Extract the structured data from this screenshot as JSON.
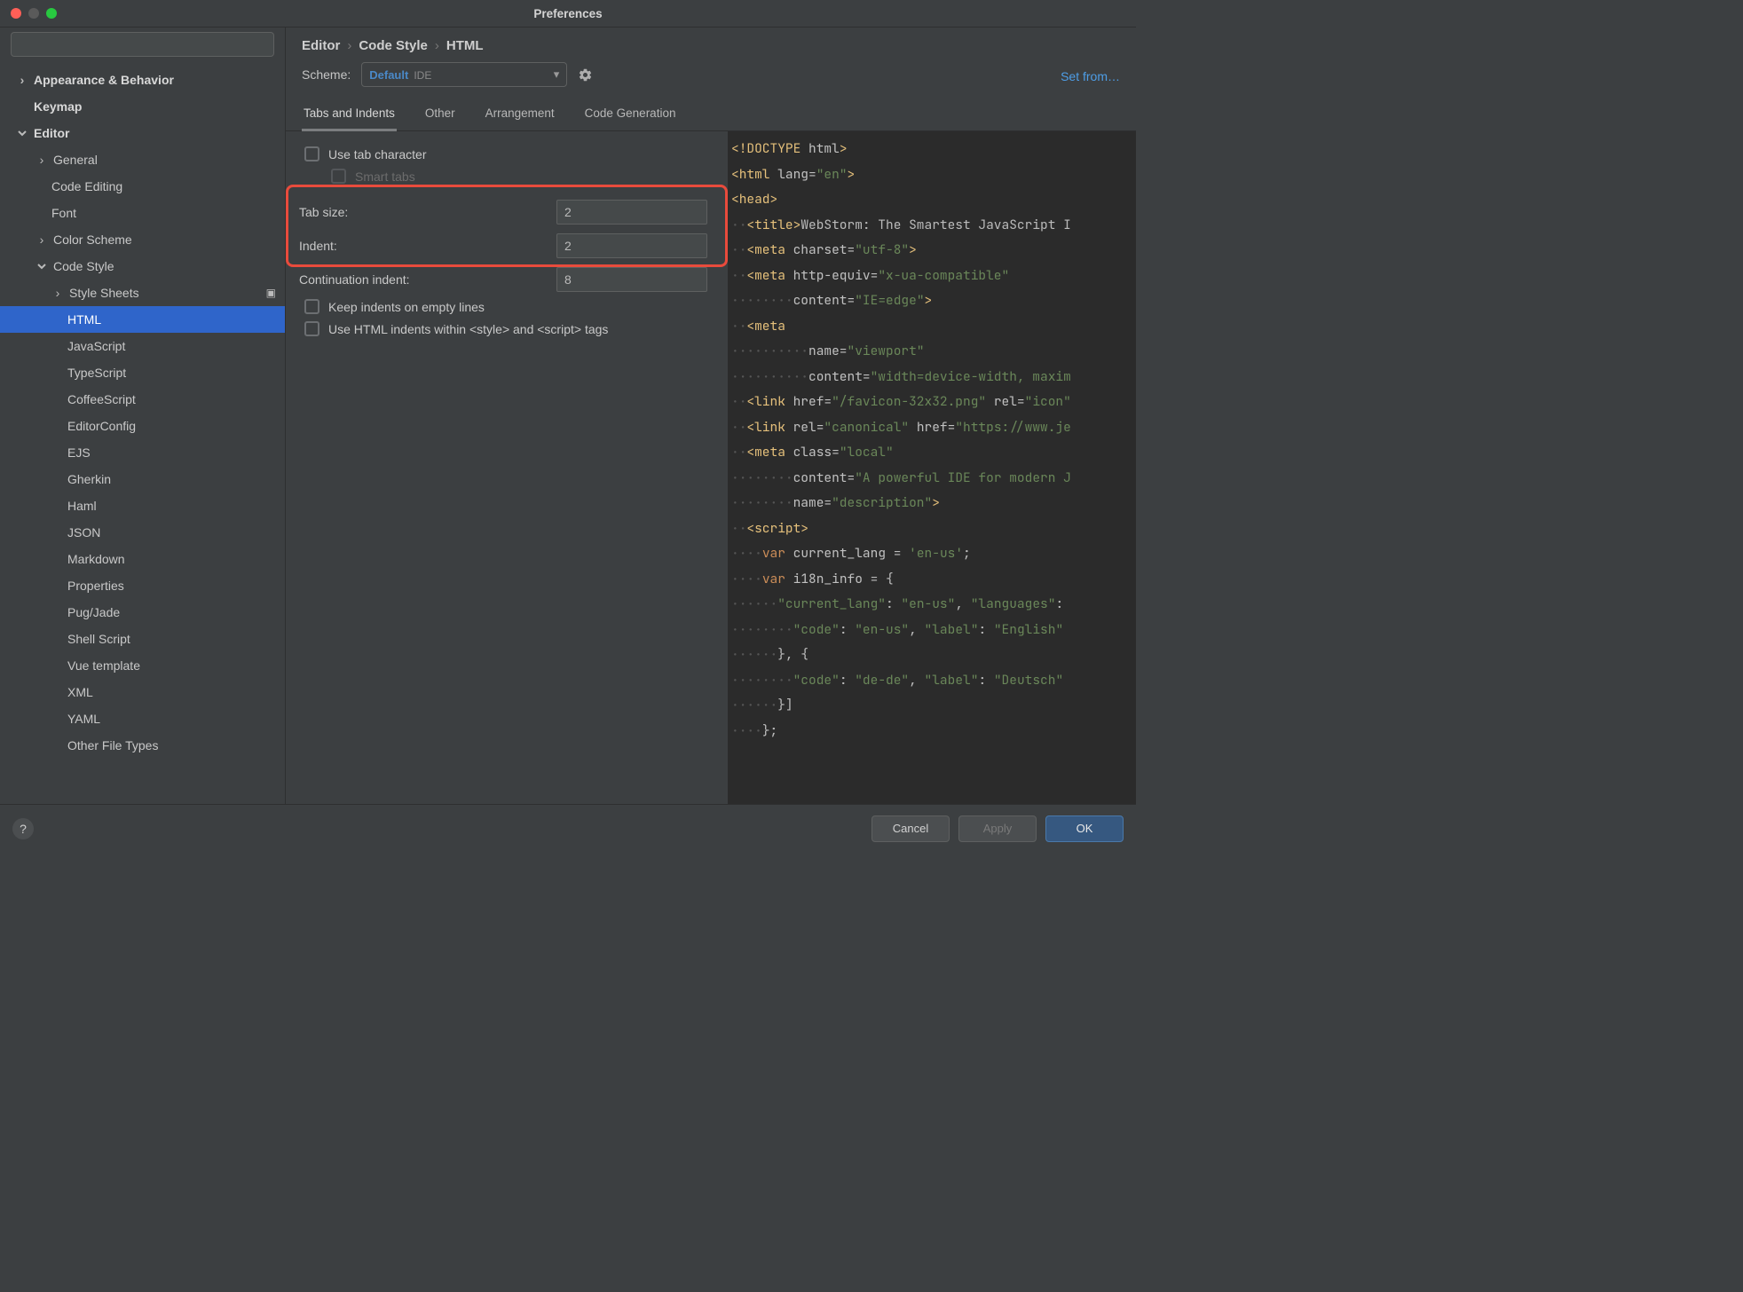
{
  "window": {
    "title": "Preferences"
  },
  "search": {
    "placeholder": ""
  },
  "sidebar": {
    "appearance": "Appearance & Behavior",
    "keymap": "Keymap",
    "editor": "Editor",
    "general": "General",
    "code_editing": "Code Editing",
    "font": "Font",
    "color_scheme": "Color Scheme",
    "code_style": "Code Style",
    "style_sheets": "Style Sheets",
    "html": "HTML",
    "javascript": "JavaScript",
    "typescript": "TypeScript",
    "coffeescript": "CoffeeScript",
    "editorconfig": "EditorConfig",
    "ejs": "EJS",
    "gherkin": "Gherkin",
    "haml": "Haml",
    "json": "JSON",
    "markdown": "Markdown",
    "properties": "Properties",
    "pugjade": "Pug/Jade",
    "shell_script": "Shell Script",
    "vue_template": "Vue template",
    "xml": "XML",
    "yaml": "YAML",
    "other_file_types": "Other File Types"
  },
  "breadcrumb": {
    "l1": "Editor",
    "l2": "Code Style",
    "l3": "HTML"
  },
  "scheme": {
    "label": "Scheme:",
    "name": "Default",
    "badge": "IDE"
  },
  "setfrom": "Set from…",
  "tabs": {
    "t0": "Tabs and Indents",
    "t1": "Other",
    "t2": "Arrangement",
    "t3": "Code Generation"
  },
  "form": {
    "use_tab": "Use tab character",
    "smart_tabs": "Smart tabs",
    "tab_size_label": "Tab size:",
    "tab_size": "2",
    "indent_label": "Indent:",
    "indent": "2",
    "cont_indent_label": "Continuation indent:",
    "cont_indent": "8",
    "keep_indents": "Keep indents on empty lines",
    "use_html_indents": "Use HTML indents within <style> and <script> tags"
  },
  "footer": {
    "cancel": "Cancel",
    "apply": "Apply",
    "ok": "OK"
  }
}
